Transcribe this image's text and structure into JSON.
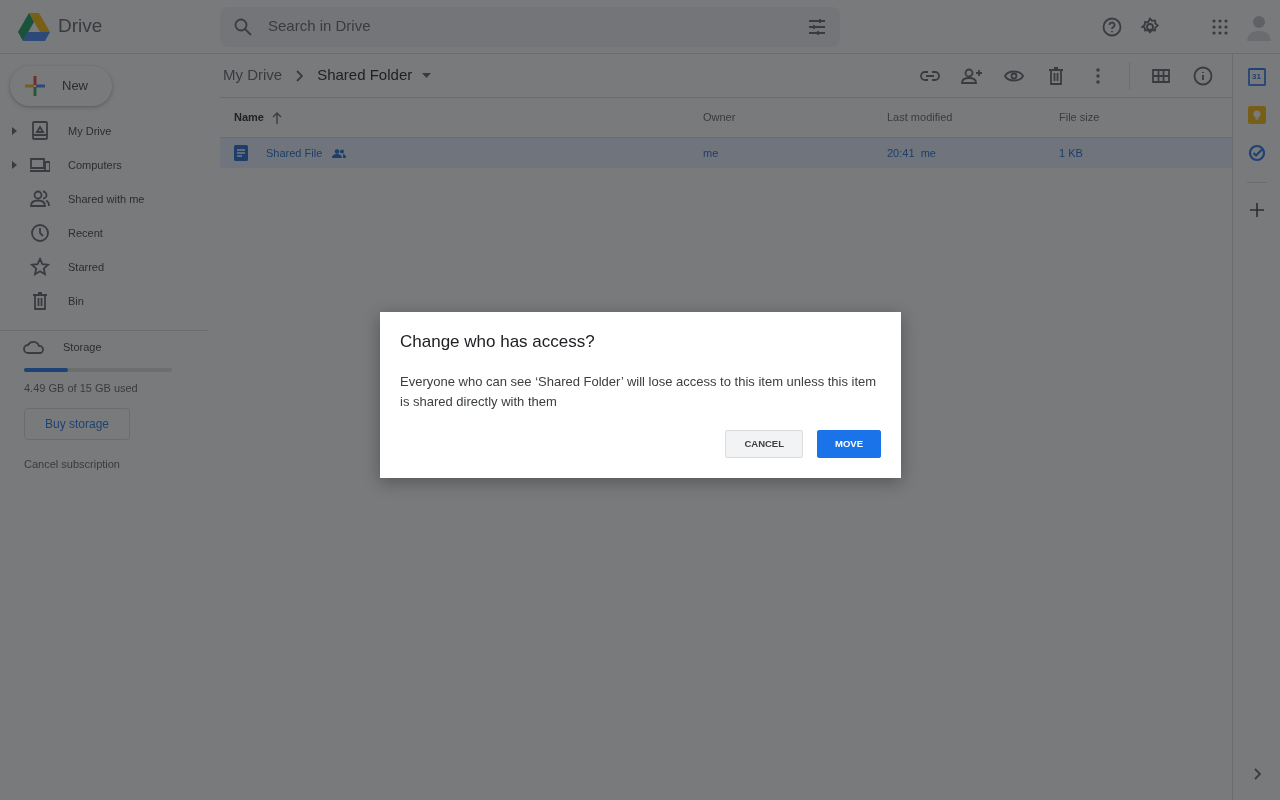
{
  "app": {
    "title": "Drive"
  },
  "search": {
    "placeholder": "Search in Drive"
  },
  "new_button": {
    "label": "New"
  },
  "sidebar": {
    "items": [
      {
        "label": "My Drive",
        "kind": "expandable"
      },
      {
        "label": "Computers",
        "kind": "expandable"
      },
      {
        "label": "Shared with me",
        "kind": "plain"
      },
      {
        "label": "Recent",
        "kind": "plain"
      },
      {
        "label": "Starred",
        "kind": "plain"
      },
      {
        "label": "Bin",
        "kind": "plain"
      }
    ]
  },
  "storage": {
    "label": "Storage",
    "level": 0.3,
    "usage": "4.49 GB of 15 GB used",
    "buy_button": "Buy storage",
    "cancel_link": "Cancel subscription"
  },
  "breadcrumb": [
    {
      "label": "My Drive",
      "current": false
    },
    {
      "label": "Shared Folder",
      "current": true
    }
  ],
  "table": {
    "columns": [
      {
        "label": "Name",
        "sorted": true
      },
      {
        "label": "Owner",
        "sorted": false
      },
      {
        "label": "Last modified",
        "sorted": false
      },
      {
        "label": "File size",
        "sorted": false
      }
    ],
    "rows": [
      {
        "name": "Shared File",
        "shared": true,
        "selected": true,
        "owner": "me",
        "modified": "20:41",
        "modified_by": "me",
        "size": "1 KB"
      }
    ]
  },
  "side_panel": {
    "calendar_date": "31"
  },
  "dialog": {
    "title": "Change who has access?",
    "message": "Everyone who can see ‘Shared Folder’ will lose access to this item unless this item is shared directly with them",
    "buttons": [
      {
        "label": "CANCEL",
        "kind": "secondary"
      },
      {
        "label": "MOVE",
        "kind": "primary"
      }
    ]
  }
}
